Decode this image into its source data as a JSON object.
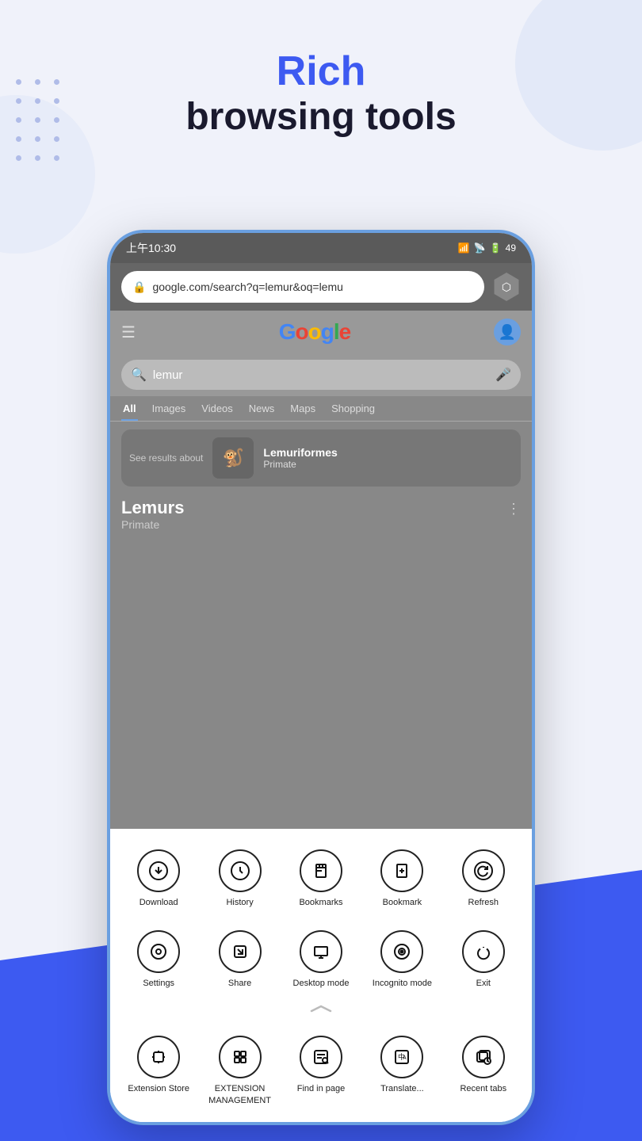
{
  "page": {
    "title_rich": "Rich",
    "title_sub": "browsing tools"
  },
  "status_bar": {
    "time": "上午10:30",
    "battery": "49"
  },
  "url_bar": {
    "url": "google.com/search?q=lemur&oq=lemu"
  },
  "browser": {
    "search_query": "lemur",
    "tabs": [
      "All",
      "Images",
      "Videos",
      "News",
      "Maps",
      "Shopping"
    ],
    "active_tab": "All",
    "see_results_label": "See results about",
    "result_card_name": "Lemuriformes",
    "result_card_sub": "Primate",
    "result_main_title": "Lemurs",
    "result_main_sub": "Primate"
  },
  "menu_row1": [
    {
      "id": "download",
      "label": "Download",
      "icon": "⬇"
    },
    {
      "id": "history",
      "label": "History",
      "icon": "🕐"
    },
    {
      "id": "bookmarks",
      "label": "Bookmarks",
      "icon": "📋"
    },
    {
      "id": "bookmark",
      "label": "Bookmark",
      "icon": "➕"
    },
    {
      "id": "refresh",
      "label": "Refresh",
      "icon": "↺"
    }
  ],
  "menu_row2": [
    {
      "id": "settings",
      "label": "Settings",
      "icon": "⚙"
    },
    {
      "id": "share",
      "label": "Share",
      "icon": "✏"
    },
    {
      "id": "desktop-mode",
      "label": "Desktop\nmode",
      "icon": "🖥"
    },
    {
      "id": "incognito-mode",
      "label": "Incognito\nmode",
      "icon": "🔍"
    },
    {
      "id": "exit",
      "label": "Exit",
      "icon": "⏻"
    }
  ],
  "menu_row3": [
    {
      "id": "extension-store",
      "label": "Extension\nStore",
      "icon": "🛍"
    },
    {
      "id": "extension-mgmt",
      "label": "EXTENSION\nMANAGEMENT",
      "icon": "📦"
    },
    {
      "id": "find-in-page",
      "label": "Find in page",
      "icon": "🔎"
    },
    {
      "id": "translate",
      "label": "Translate...",
      "icon": "🌐"
    },
    {
      "id": "recent-tabs",
      "label": "Recent tabs",
      "icon": "🕐"
    }
  ]
}
